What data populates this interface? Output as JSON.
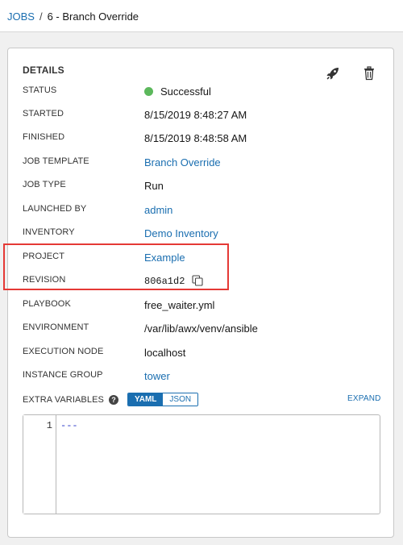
{
  "breadcrumb": {
    "parent": "JOBS",
    "separator": "/",
    "current": "6 - Branch Override"
  },
  "details": {
    "title": "DETAILS",
    "rows": [
      {
        "label": "STATUS",
        "value": "Successful"
      },
      {
        "label": "STARTED",
        "value": "8/15/2019 8:48:27 AM"
      },
      {
        "label": "FINISHED",
        "value": "8/15/2019 8:48:58 AM"
      },
      {
        "label": "JOB TEMPLATE",
        "value": "Branch Override"
      },
      {
        "label": "JOB TYPE",
        "value": "Run"
      },
      {
        "label": "LAUNCHED BY",
        "value": "admin"
      },
      {
        "label": "INVENTORY",
        "value": "Demo Inventory"
      },
      {
        "label": "PROJECT",
        "value": "Example"
      },
      {
        "label": "REVISION",
        "value": "806a1d2"
      },
      {
        "label": "PLAYBOOK",
        "value": "free_waiter.yml"
      },
      {
        "label": "ENVIRONMENT",
        "value": "/var/lib/awx/venv/ansible"
      },
      {
        "label": "EXECUTION NODE",
        "value": "localhost"
      },
      {
        "label": "INSTANCE GROUP",
        "value": "tower"
      }
    ]
  },
  "extra_variables": {
    "label": "EXTRA VARIABLES",
    "help": "?",
    "toggle": {
      "yaml": "YAML",
      "json": "JSON",
      "selected": "YAML"
    },
    "expand_label": "EXPAND",
    "editor": {
      "line_number": "1",
      "content": "---"
    }
  },
  "icons": {
    "launch": "rocket-icon",
    "delete": "trash-icon",
    "copy": "copy-icon",
    "status": "status-dot"
  },
  "colors": {
    "link": "#1a6eb0",
    "success": "#5cb85c",
    "highlight": "#e53935"
  }
}
